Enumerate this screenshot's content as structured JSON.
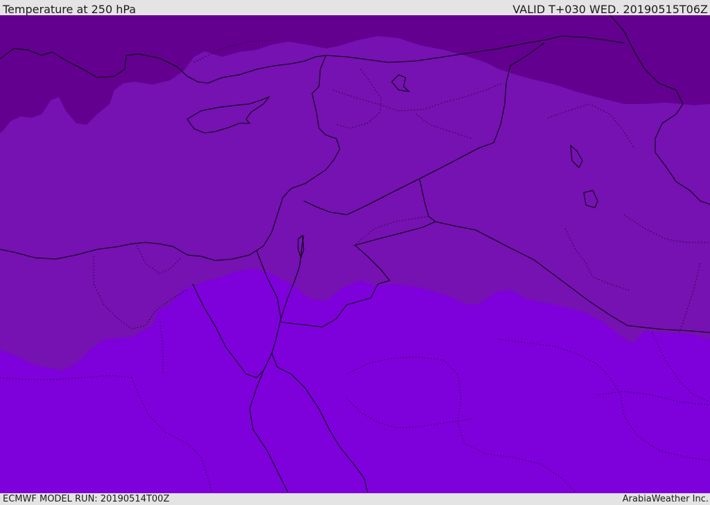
{
  "header": {
    "title": "Temperature at 250 hPa",
    "valid": "VALID T+030 WED. 20190515T06Z"
  },
  "footer": {
    "model_run": "ECMWF MODEL RUN: 20190514T00Z",
    "credit": "ArabiaWeather Inc."
  },
  "map": {
    "field": "Temperature at 250 hPa",
    "region": "Eastern Mediterranean / Middle East",
    "colors": {
      "coldest_band": "#63008f",
      "middle_band": "#7611b2",
      "warmest_band": "#7e00db",
      "border_line": "#000000"
    }
  }
}
